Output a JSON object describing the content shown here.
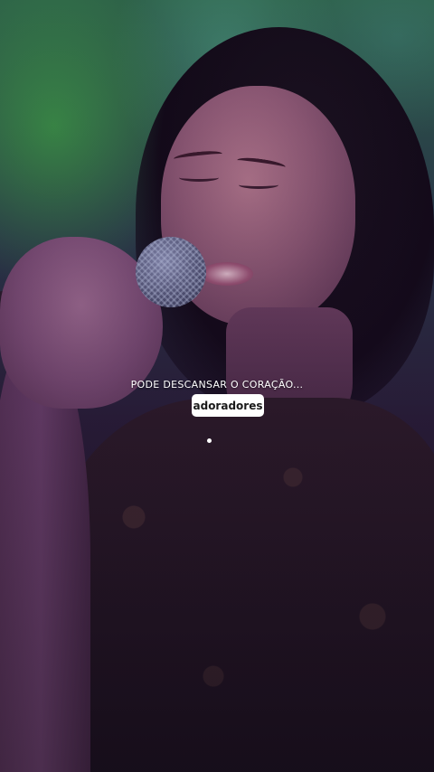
{
  "overlay": {
    "caption": "PODE DESCANSAR O CORAÇÃO...",
    "tag_label": "adoradores"
  },
  "colors": {
    "caption_text": "#ffffff",
    "tag_background": "#ffffff",
    "tag_text": "#1a1a1a"
  }
}
